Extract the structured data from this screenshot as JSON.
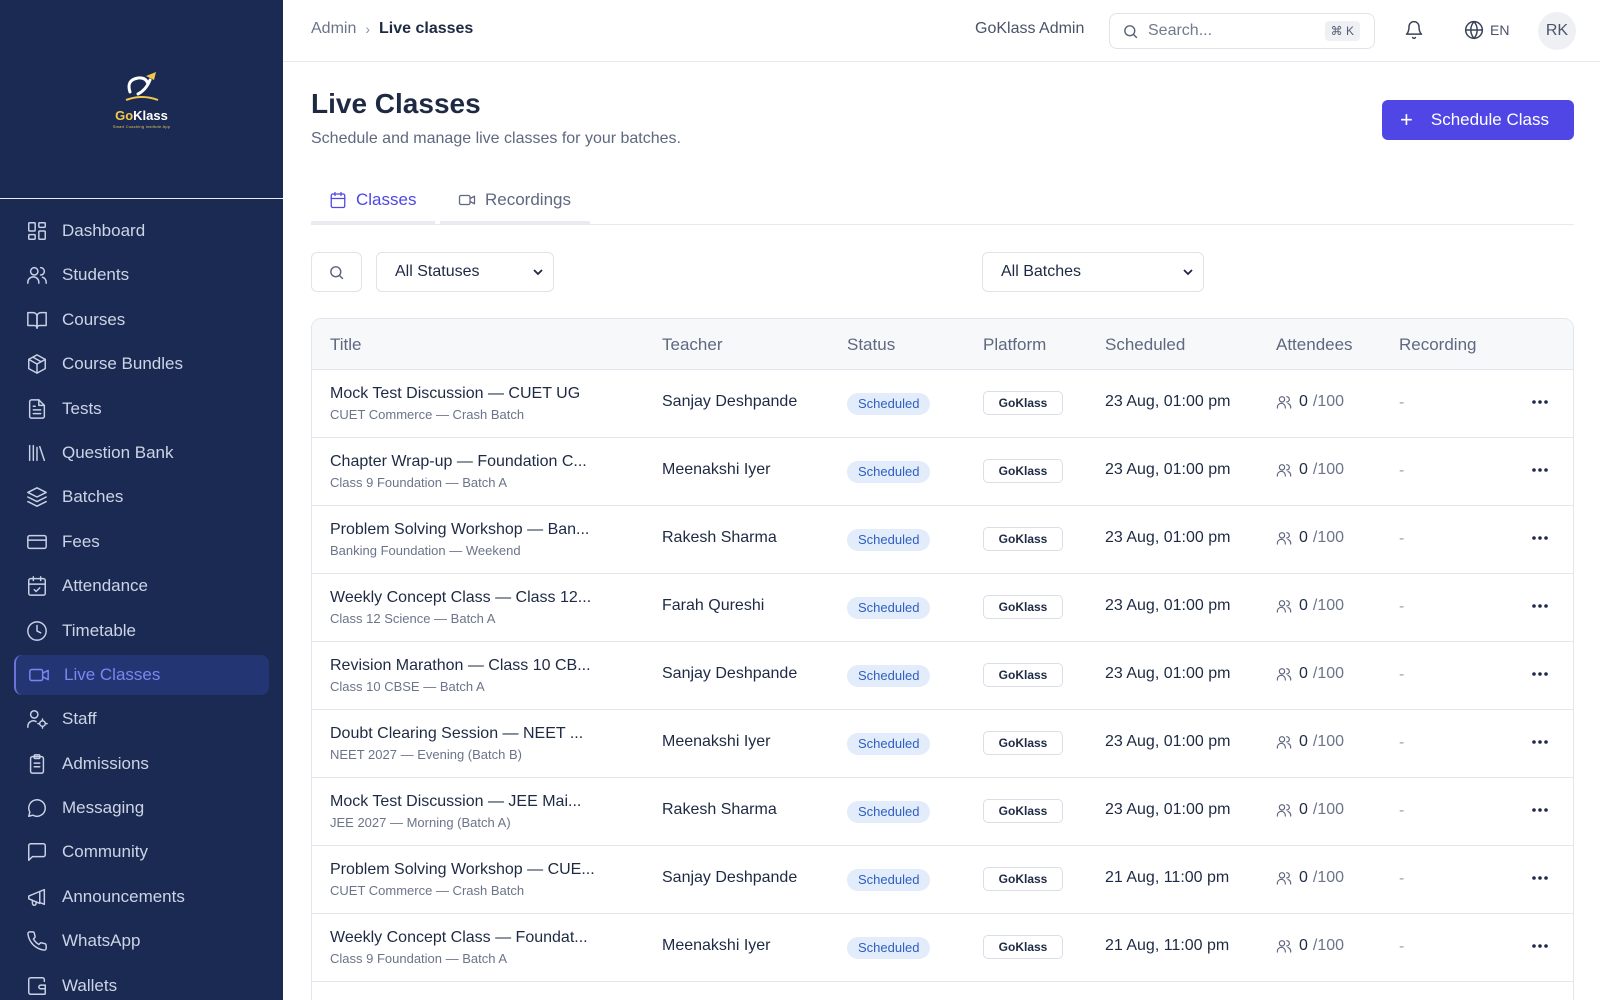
{
  "logo": {
    "name_part1": "Go",
    "name_part2": "Klass",
    "tagline": "Smart Coaching Institute App"
  },
  "sidebar": {
    "items": [
      {
        "label": "Dashboard",
        "icon": "dashboard-icon",
        "active": false
      },
      {
        "label": "Students",
        "icon": "users-icon",
        "active": false
      },
      {
        "label": "Courses",
        "icon": "book-icon",
        "active": false
      },
      {
        "label": "Course Bundles",
        "icon": "package-icon",
        "active": false
      },
      {
        "label": "Tests",
        "icon": "file-text-icon",
        "active": false
      },
      {
        "label": "Question Bank",
        "icon": "library-icon",
        "active": false
      },
      {
        "label": "Batches",
        "icon": "layers-icon",
        "active": false
      },
      {
        "label": "Fees",
        "icon": "credit-card-icon",
        "active": false
      },
      {
        "label": "Attendance",
        "icon": "calendar-check-icon",
        "active": false
      },
      {
        "label": "Timetable",
        "icon": "clock-icon",
        "active": false
      },
      {
        "label": "Live Classes",
        "icon": "video-icon",
        "active": true
      },
      {
        "label": "Staff",
        "icon": "user-cog-icon",
        "active": false
      },
      {
        "label": "Admissions",
        "icon": "clipboard-icon",
        "active": false
      },
      {
        "label": "Messaging",
        "icon": "message-circle-icon",
        "active": false
      },
      {
        "label": "Community",
        "icon": "message-square-icon",
        "active": false
      },
      {
        "label": "Announcements",
        "icon": "megaphone-icon",
        "active": false
      },
      {
        "label": "WhatsApp",
        "icon": "phone-icon",
        "active": false
      },
      {
        "label": "Wallets",
        "icon": "wallet-icon",
        "active": false
      }
    ]
  },
  "topbar": {
    "breadcrumb_root": "Admin",
    "breadcrumb_current": "Live classes",
    "org_name": "GoKlass Admin",
    "search_placeholder": "Search...",
    "search_shortcut": "⌘ K",
    "language": "EN",
    "avatar_initials": "RK"
  },
  "page": {
    "title": "Live Classes",
    "subtitle": "Schedule and manage live classes for your batches.",
    "schedule_button": "Schedule Class",
    "tabs": [
      {
        "label": "Classes",
        "active": true
      },
      {
        "label": "Recordings",
        "active": false
      }
    ]
  },
  "filters": {
    "status_selected": "All Statuses",
    "batch_selected": "All Batches"
  },
  "table": {
    "columns": [
      "Title",
      "Teacher",
      "Status",
      "Platform",
      "Scheduled",
      "Attendees",
      "Recording"
    ],
    "rows": [
      {
        "title": "Mock Test Discussion — CUET UG",
        "batch": "CUET Commerce — Crash Batch",
        "teacher": "Sanjay Deshpande",
        "status": "Scheduled",
        "platform": "GoKlass",
        "scheduled": "23 Aug, 01:00 pm",
        "attendees": "0",
        "capacity": "/100",
        "recording": "-"
      },
      {
        "title": "Chapter Wrap-up — Foundation C...",
        "batch": "Class 9 Foundation — Batch A",
        "teacher": "Meenakshi Iyer",
        "status": "Scheduled",
        "platform": "GoKlass",
        "scheduled": "23 Aug, 01:00 pm",
        "attendees": "0",
        "capacity": "/100",
        "recording": "-"
      },
      {
        "title": "Problem Solving Workshop — Ban...",
        "batch": "Banking Foundation — Weekend",
        "teacher": "Rakesh Sharma",
        "status": "Scheduled",
        "platform": "GoKlass",
        "scheduled": "23 Aug, 01:00 pm",
        "attendees": "0",
        "capacity": "/100",
        "recording": "-"
      },
      {
        "title": "Weekly Concept Class — Class 12...",
        "batch": "Class 12 Science — Batch A",
        "teacher": "Farah Qureshi",
        "status": "Scheduled",
        "platform": "GoKlass",
        "scheduled": "23 Aug, 01:00 pm",
        "attendees": "0",
        "capacity": "/100",
        "recording": "-"
      },
      {
        "title": "Revision Marathon — Class 10 CB...",
        "batch": "Class 10 CBSE — Batch A",
        "teacher": "Sanjay Deshpande",
        "status": "Scheduled",
        "platform": "GoKlass",
        "scheduled": "23 Aug, 01:00 pm",
        "attendees": "0",
        "capacity": "/100",
        "recording": "-"
      },
      {
        "title": "Doubt Clearing Session — NEET ...",
        "batch": "NEET 2027 — Evening (Batch B)",
        "teacher": "Meenakshi Iyer",
        "status": "Scheduled",
        "platform": "GoKlass",
        "scheduled": "23 Aug, 01:00 pm",
        "attendees": "0",
        "capacity": "/100",
        "recording": "-"
      },
      {
        "title": "Mock Test Discussion — JEE Mai...",
        "batch": "JEE 2027 — Morning (Batch A)",
        "teacher": "Rakesh Sharma",
        "status": "Scheduled",
        "platform": "GoKlass",
        "scheduled": "23 Aug, 01:00 pm",
        "attendees": "0",
        "capacity": "/100",
        "recording": "-"
      },
      {
        "title": "Problem Solving Workshop — CUE...",
        "batch": "CUET Commerce — Crash Batch",
        "teacher": "Sanjay Deshpande",
        "status": "Scheduled",
        "platform": "GoKlass",
        "scheduled": "21 Aug, 11:00 pm",
        "attendees": "0",
        "capacity": "/100",
        "recording": "-"
      },
      {
        "title": "Weekly Concept Class — Foundat...",
        "batch": "Class 9 Foundation — Batch A",
        "teacher": "Meenakshi Iyer",
        "status": "Scheduled",
        "platform": "GoKlass",
        "scheduled": "21 Aug, 11:00 pm",
        "attendees": "0",
        "capacity": "/100",
        "recording": "-"
      }
    ]
  }
}
